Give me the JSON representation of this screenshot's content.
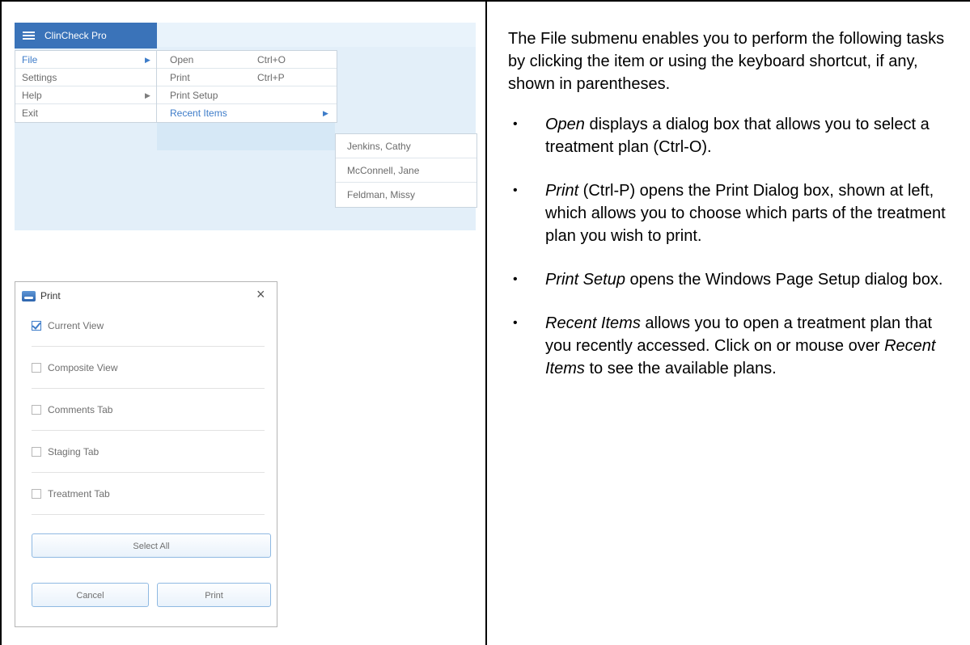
{
  "menu": {
    "app_title": "ClinCheck Pro",
    "main_items": [
      "File",
      "Settings",
      "Help",
      "Exit"
    ],
    "file_items": [
      {
        "label": "Open",
        "shortcut": "Ctrl+O"
      },
      {
        "label": "Print",
        "shortcut": "Ctrl+P"
      },
      {
        "label": "Print Setup",
        "shortcut": ""
      },
      {
        "label": "Recent Items",
        "shortcut": ""
      }
    ],
    "recent_items": [
      "Jenkins, Cathy",
      "McConnell, Jane",
      "Feldman, Missy"
    ],
    "accent_color": "#3d7cc9",
    "header_color": "#3a73b9"
  },
  "dialog": {
    "title": "Print",
    "close_glyph": "×",
    "options": [
      {
        "label": "Current View",
        "checked": true
      },
      {
        "label": "Composite View",
        "checked": false
      },
      {
        "label": "Comments Tab",
        "checked": false
      },
      {
        "label": "Staging Tab",
        "checked": false
      },
      {
        "label": "Treatment Tab",
        "checked": false
      }
    ],
    "select_all_label": "Select All",
    "cancel_label": "Cancel",
    "print_label": "Print"
  },
  "text": {
    "intro": "The File submenu enables you to perform the following tasks by clicking the item or using the keyboard shortcut, if any, shown in parentheses.",
    "bullet_glyph": "•",
    "bullets": [
      {
        "term": "Open",
        "rest": " displays a dialog box that allows you to select a treatment plan (Ctrl-O)."
      },
      {
        "term": "Print",
        "rest": " (Ctrl-P) opens the Print Dialog box, shown at left, which allows you to choose which parts of the treatment plan you wish to print."
      },
      {
        "term": "Print Setup",
        "rest": " opens the Windows Page Setup dialog box."
      },
      {
        "term": "Recent Items",
        "rest": " allows you to open a treatment plan that you recently accessed. Click on or mouse over ",
        "term2": "Recent Items",
        "rest2": " to see the available plans."
      }
    ]
  }
}
